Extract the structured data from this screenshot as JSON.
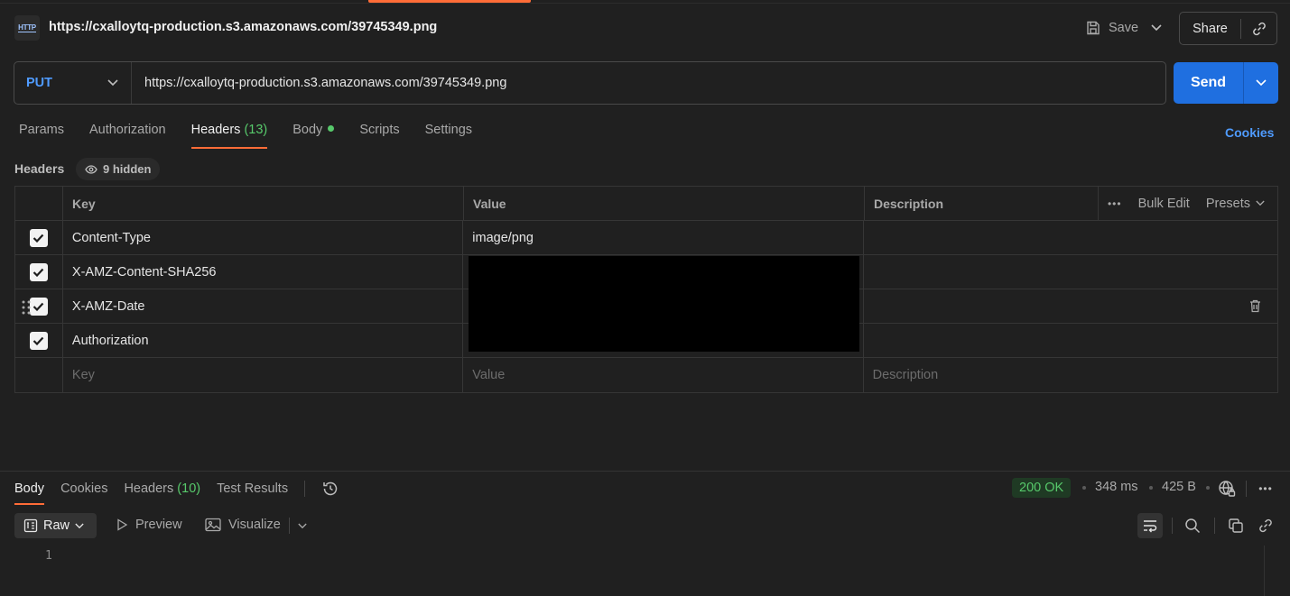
{
  "header": {
    "badge": "HTTP",
    "title": "https://cxalloytq-production.s3.amazonaws.com/39745349.png",
    "save_label": "Save",
    "share_label": "Share"
  },
  "request": {
    "method": "PUT",
    "url": "https://cxalloytq-production.s3.amazonaws.com/39745349.png",
    "send_label": "Send"
  },
  "tabs": {
    "params": "Params",
    "authorization": "Authorization",
    "headers": "Headers",
    "headers_count": "(13)",
    "body": "Body",
    "scripts": "Scripts",
    "settings": "Settings",
    "cookies": "Cookies"
  },
  "headers_section": {
    "label": "Headers",
    "hidden": "9 hidden",
    "columns": {
      "key": "Key",
      "value": "Value",
      "description": "Description"
    },
    "bulk_edit": "Bulk Edit",
    "presets": "Presets",
    "rows": [
      {
        "key": "Content-Type",
        "value": "image/png"
      },
      {
        "key": "X-AMZ-Content-SHA256",
        "value": ""
      },
      {
        "key": "X-AMZ-Date",
        "value": ""
      },
      {
        "key": "Authorization",
        "value": ""
      }
    ],
    "placeholders": {
      "key": "Key",
      "value": "Value",
      "description": "Description"
    }
  },
  "response": {
    "tabs": {
      "body": "Body",
      "cookies": "Cookies",
      "headers": "Headers",
      "headers_count": "(10)",
      "test_results": "Test Results"
    },
    "status": "200 OK",
    "time": "348 ms",
    "size": "425 B",
    "format": "Raw",
    "preview": "Preview",
    "visualize": "Visualize",
    "line_number": "1"
  },
  "colors": {
    "accent": "#ff6c37",
    "send": "#1f6fe0",
    "method": "#4f9bff",
    "success": "#57c96b"
  }
}
